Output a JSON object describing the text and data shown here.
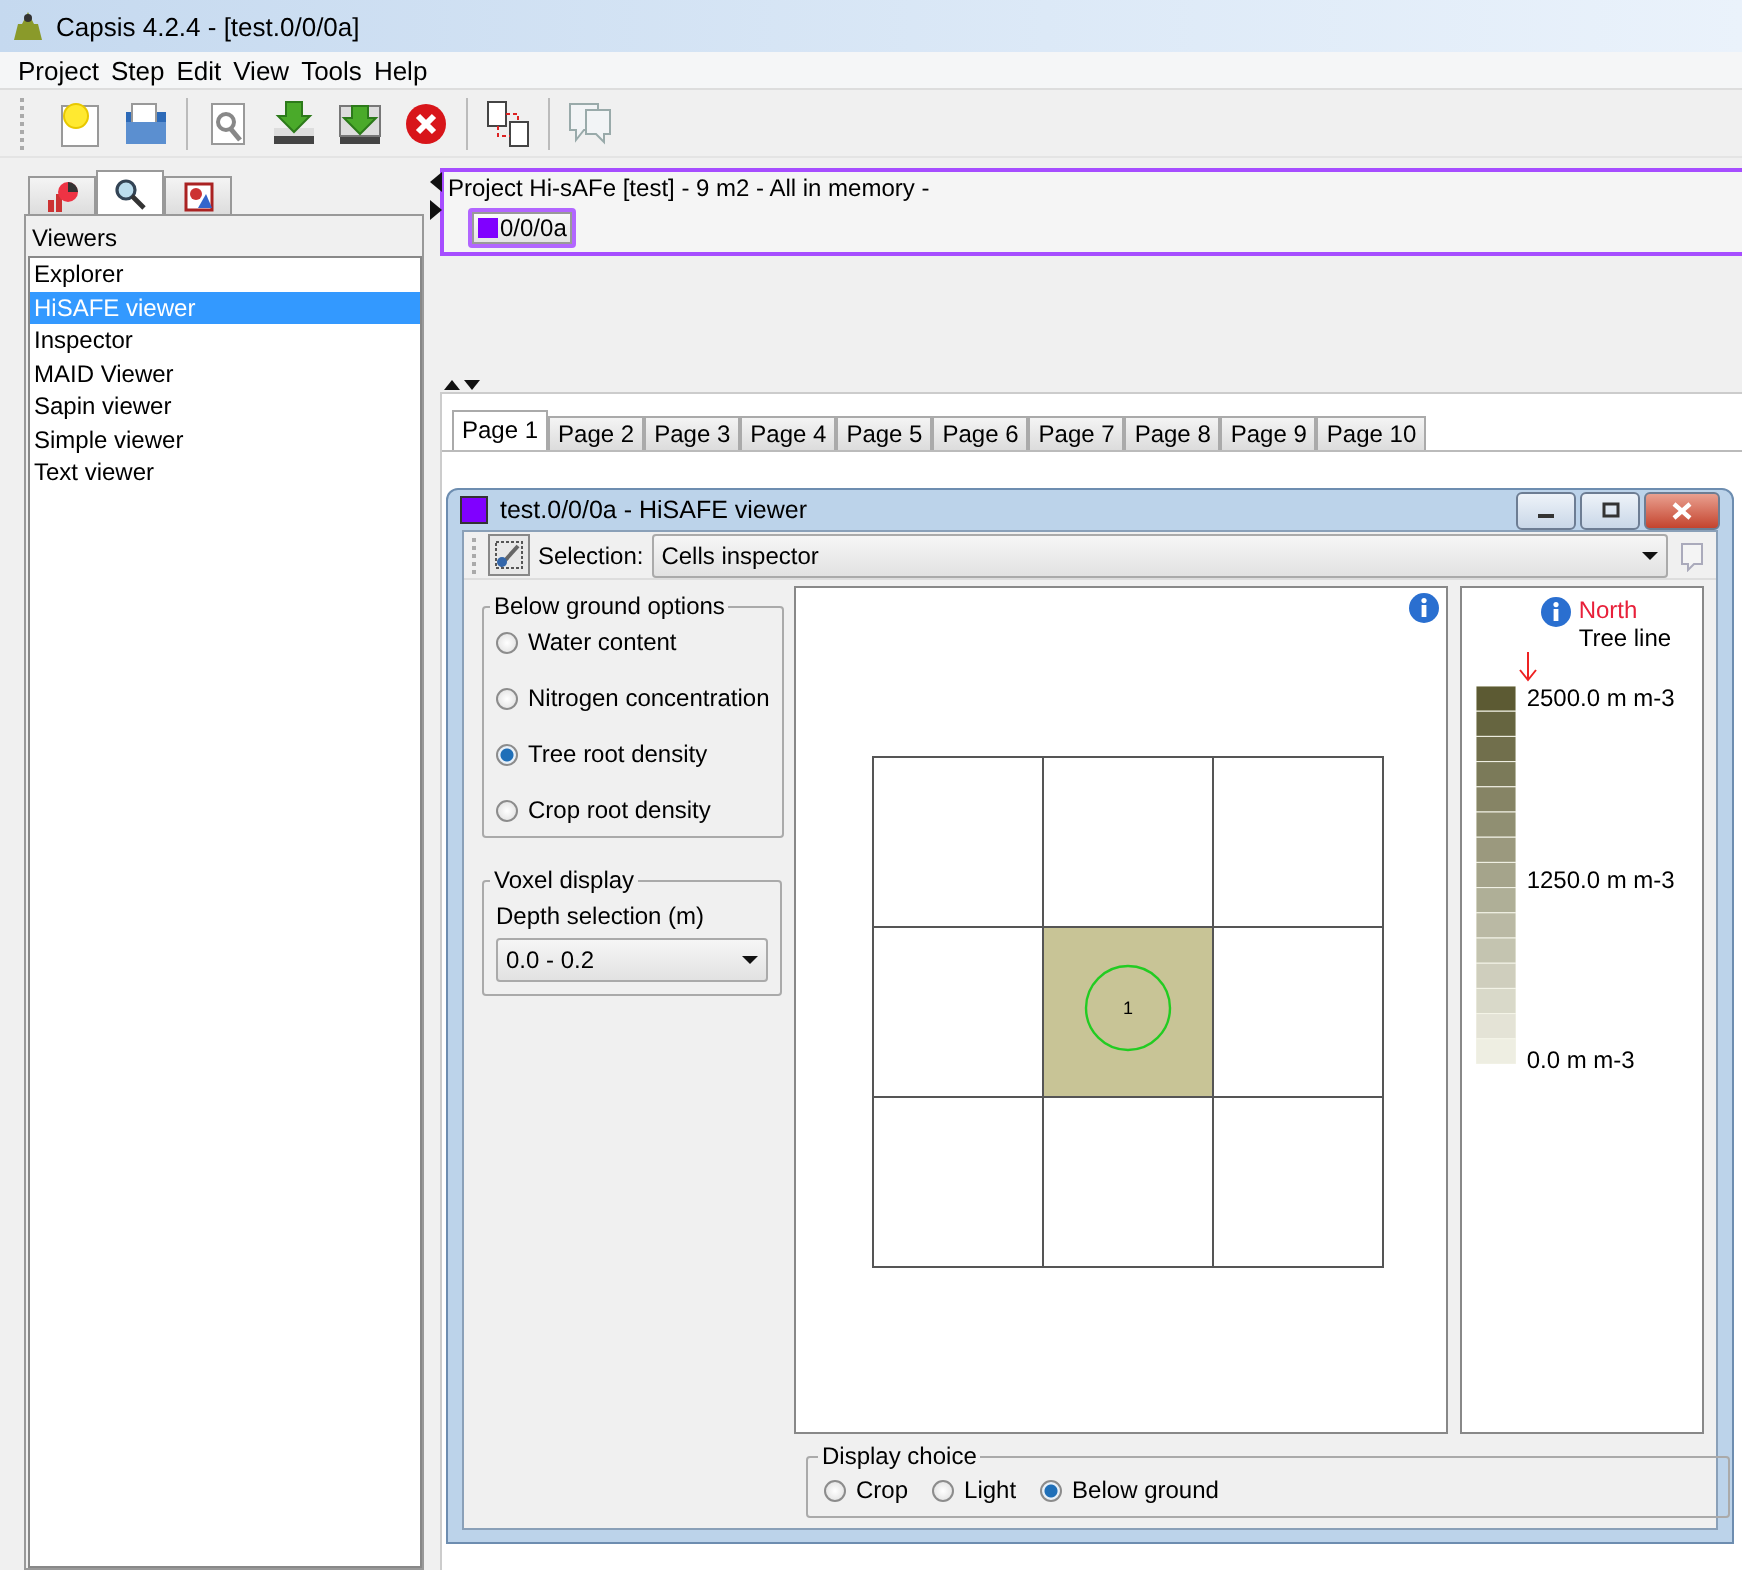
{
  "window": {
    "title": "Capsis 4.2.4 - [test.0/0/0a]"
  },
  "menu": [
    "Project",
    "Step",
    "Edit",
    "View",
    "Tools",
    "Help"
  ],
  "side_tabs": [
    {
      "selected": false
    },
    {
      "selected": true
    },
    {
      "selected": false
    }
  ],
  "sidebar": {
    "heading": "Viewers",
    "items": [
      {
        "label": "Explorer",
        "selected": false
      },
      {
        "label": "HiSAFE viewer",
        "selected": true
      },
      {
        "label": "Inspector",
        "selected": false
      },
      {
        "label": "MAID Viewer",
        "selected": false
      },
      {
        "label": "Sapin viewer",
        "selected": false
      },
      {
        "label": "Simple viewer",
        "selected": false
      },
      {
        "label": "Text viewer",
        "selected": false
      }
    ]
  },
  "project": {
    "title": "Project Hi-sAFe [test] - 9 m2 - All in memory -",
    "steps": [
      {
        "label": "0/0/0a",
        "selected": true
      }
    ]
  },
  "pages": [
    {
      "label": "Page 1",
      "selected": true
    },
    {
      "label": "Page 2",
      "selected": false
    },
    {
      "label": "Page 3",
      "selected": false
    },
    {
      "label": "Page 4",
      "selected": false
    },
    {
      "label": "Page 5",
      "selected": false
    },
    {
      "label": "Page 6",
      "selected": false
    },
    {
      "label": "Page 7",
      "selected": false
    },
    {
      "label": "Page 8",
      "selected": false
    },
    {
      "label": "Page 9",
      "selected": false
    },
    {
      "label": "Page 10",
      "selected": false
    }
  ],
  "viewer": {
    "title": "test.0/0/0a - HiSAFE viewer",
    "selection_label": "Selection:",
    "selection_value": "Cells inspector",
    "below_ground": {
      "title": "Below ground options",
      "options": [
        {
          "label": "Water content",
          "selected": false
        },
        {
          "label": "Nitrogen concentration",
          "selected": false
        },
        {
          "label": "Tree root density",
          "selected": true
        },
        {
          "label": "Crop root density",
          "selected": false
        }
      ]
    },
    "voxel": {
      "title": "Voxel display",
      "depth_label": "Depth selection (m)",
      "depth_value": "0.0 - 0.2"
    },
    "grid": {
      "cells": [
        {
          "filled": false
        },
        {
          "filled": false
        },
        {
          "filled": false
        },
        {
          "filled": false
        },
        {
          "filled": true,
          "tree": "1"
        },
        {
          "filled": false
        },
        {
          "filled": false
        },
        {
          "filled": false
        },
        {
          "filled": false
        }
      ]
    },
    "legend": {
      "north": "North",
      "tree_line": "Tree line",
      "labels": [
        "2500.0 m m-3",
        "1250.0 m m-3",
        "0.0 m m-3"
      ]
    },
    "display_choice": {
      "title": "Display choice",
      "options": [
        {
          "label": "Crop",
          "selected": false
        },
        {
          "label": "Light",
          "selected": false
        },
        {
          "label": "Below ground",
          "selected": true
        }
      ]
    }
  }
}
